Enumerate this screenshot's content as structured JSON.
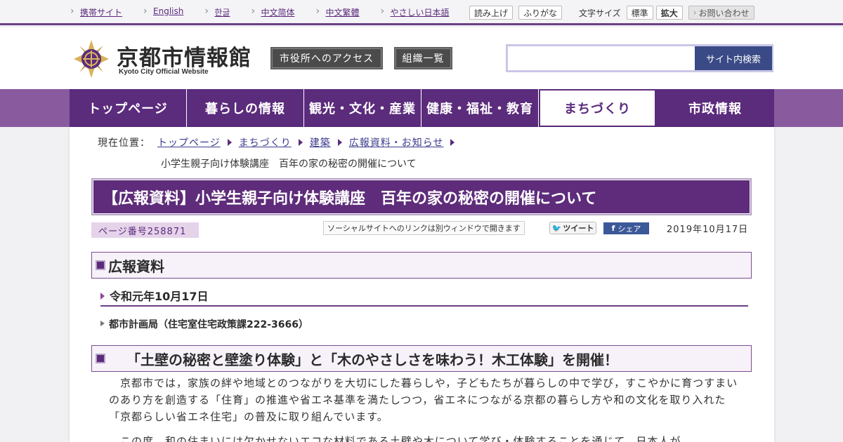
{
  "utility": {
    "links": [
      "携帯サイト",
      "English",
      "한글",
      "中文简体",
      "中文繁體",
      "やさしい日本語"
    ],
    "read_aloud": "読み上げ",
    "furigana": "ふりがな",
    "font_size_label": "文字サイズ",
    "font_standard": "標準",
    "font_large": "拡大",
    "contact": "お問い合わせ"
  },
  "header": {
    "logo_title": "京都市情報館",
    "logo_subtitle": "Kyoto City Official Website",
    "access_button": "市役所へのアクセス",
    "org_button": "組織一覧",
    "search_button": "サイト内検索",
    "search_value": ""
  },
  "nav": {
    "items": [
      "トップページ",
      "暮らしの情報",
      "観光・文化・産業",
      "健康・福祉・教育",
      "まちづくり",
      "市政情報"
    ],
    "active_index": 4
  },
  "breadcrumb": {
    "label": "現在位置：",
    "items": [
      "トップページ",
      "まちづくり",
      "建築",
      "広報資料・お知らせ"
    ],
    "current": "小学生親子向け体験講座　百年の家の秘密の開催について"
  },
  "page": {
    "title": "【広報資料】小学生親子向け体験講座　百年の家の秘密の開催について",
    "page_number": "ページ番号258871",
    "social_note": "ソーシャルサイトへのリンクは別ウィンドウで開きます",
    "tweet": "ツイート",
    "share": "シェア",
    "date": "2019年10月17日"
  },
  "article": {
    "h2_press": "広報資料",
    "h3_date": "令和元年10月17日",
    "h4_dept": "都市計画局（住宅室住宅政策課222-3666）",
    "h2_event": "「土壁の秘密と壁塗り体験」と「木のやさしさを味わう！木工体験」を開催！",
    "p1": "　京都市では，家族の絆や地域とのつながりを大切にした暮らしや，子どもたちが暮らしの中で学び，すこやかに育つすまいのあり方を創造する「住育」の推進や省エネ基準を満たしつつ，省エネにつながる京都の暮らし方や和の文化を取り入れた「京都らしい省エネ住宅」の普及に取り組んでいます。",
    "p2": "　この度，和の住まいには欠かせないエコな材料である土壁や木について学び・体験することを通じて，日本人が"
  },
  "colors": {
    "brand_purple": "#5b2b7c",
    "nav_band": "#8a5a9f",
    "search_button": "#3a4a86"
  }
}
